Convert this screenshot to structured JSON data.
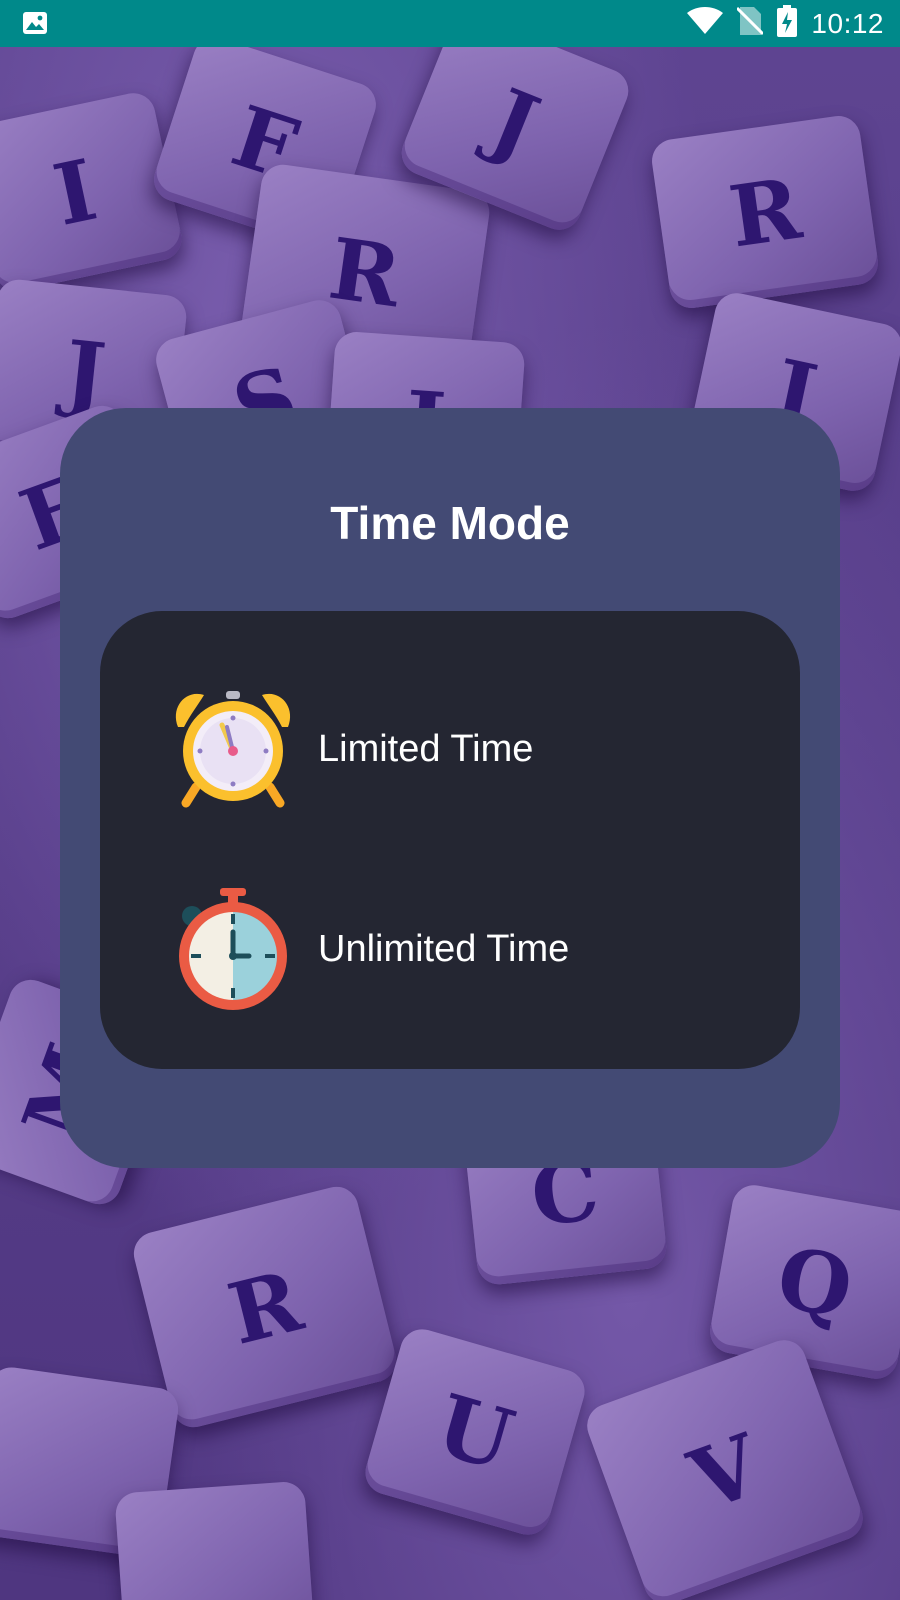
{
  "status_bar": {
    "time": "10:12",
    "icons": [
      "image-icon",
      "wifi-icon",
      "no-sim-icon",
      "battery-charging-icon"
    ]
  },
  "background": {
    "letters": [
      "I",
      "F",
      "R",
      "J",
      "R",
      "J",
      "S",
      "J",
      "E",
      "J",
      "R",
      "M",
      "Q",
      "C",
      "U",
      "V"
    ]
  },
  "dialog": {
    "title": "Time Mode",
    "options": [
      {
        "label": "Limited Time",
        "icon": "alarm-clock-icon"
      },
      {
        "label": "Unlimited Time",
        "icon": "stopwatch-icon"
      }
    ]
  },
  "colors": {
    "status_bar": "#00898a",
    "dialog_bg": "#434a74",
    "panel_bg": "#242632",
    "text": "#ffffff"
  }
}
